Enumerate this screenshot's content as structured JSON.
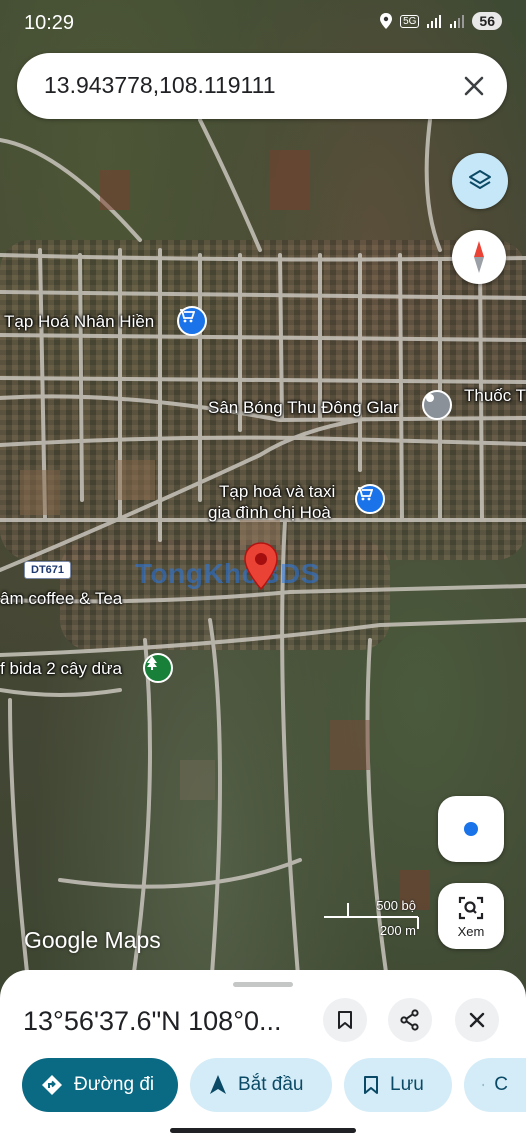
{
  "status_bar": {
    "time": "10:29",
    "network": "5G",
    "battery": "56"
  },
  "search": {
    "value": "13.943778,108.119111"
  },
  "map": {
    "labels": {
      "shop1": "Tạp Hoá Nhân Hiền",
      "stadium": "Sân Bóng Thu Đông Glar",
      "edge_right": "Thuốc T",
      "shop2_line1": "Tạp hoá và taxi",
      "shop2_line2": "gia đình chị Hoà",
      "coffee": "âm coffee & Tea",
      "bida": "f bida 2 cây dừa"
    },
    "route_badge": "DT671",
    "watermark": "TongKhoBDS",
    "scale": {
      "imperial": "500 bộ",
      "metric": "200 m"
    },
    "attribution": "Google Maps",
    "lens_label": "Xem"
  },
  "sheet": {
    "title": "13°56'37.6\"N 108°0...",
    "chips": {
      "directions": "Đường đi",
      "start": "Bắt đầu",
      "save": "Lưu",
      "share": "C"
    }
  },
  "colors": {
    "primary": "#0b6a83",
    "chip": "#d3ecf7",
    "pin_red": "#ea4335",
    "shop_blue": "#1a73e8"
  }
}
